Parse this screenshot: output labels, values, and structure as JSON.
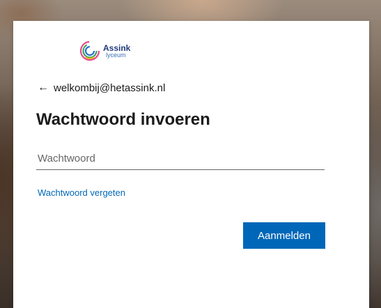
{
  "branding": {
    "name": "Assink",
    "subtitle": "lyceum",
    "logo_icon": "assink-lyceum-logo-icon",
    "colors": {
      "ring_outer": "#e84a8a",
      "ring_mid": "#3aa35a",
      "ring_inner": "#2a6fcf",
      "accent": "#e8b820",
      "name_text": "#243b7a",
      "sub_text": "#3a6fb8"
    }
  },
  "identity": {
    "back_icon": "back-arrow-icon",
    "back_glyph": "←",
    "email": "welkombij@hetassink.nl"
  },
  "title": "Wachtwoord invoeren",
  "password_field": {
    "placeholder": "Wachtwoord",
    "value": ""
  },
  "forgot_link": "Wachtwoord vergeten",
  "signin_button": "Aanmelden",
  "theme": {
    "primary": "#0067b8",
    "text": "#1b1b1b",
    "muted": "#666666",
    "card_bg": "#ffffff"
  }
}
